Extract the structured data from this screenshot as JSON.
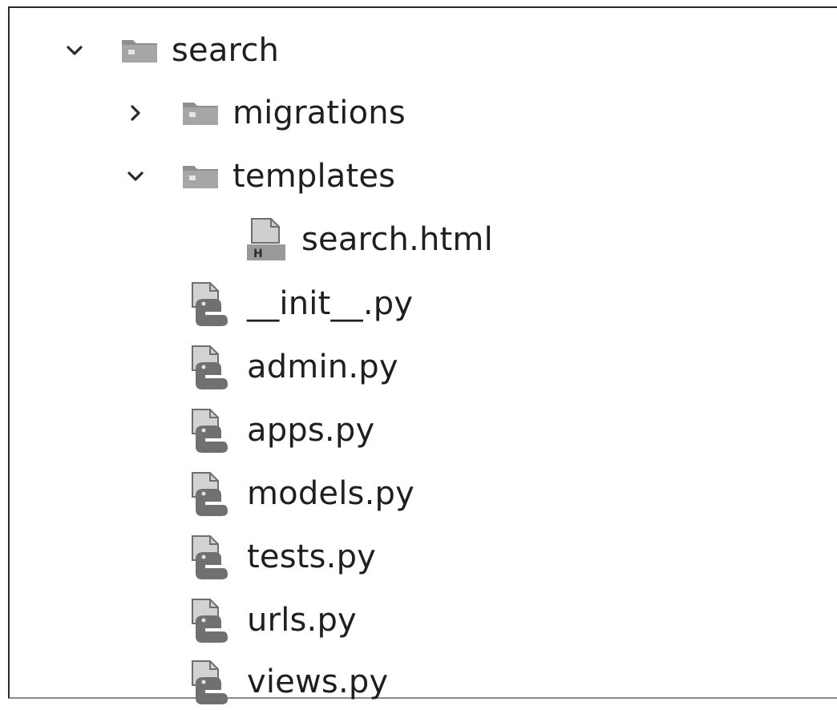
{
  "tree": {
    "root": {
      "label": "search",
      "expanded": true,
      "icon": "folder-icon"
    },
    "items": [
      {
        "label": "migrations",
        "expanded": false,
        "type": "folder",
        "icon": "folder-icon"
      },
      {
        "label": "templates",
        "expanded": true,
        "type": "folder",
        "icon": "folder-icon"
      },
      {
        "label": "search.html",
        "type": "file",
        "icon": "html-file-icon"
      },
      {
        "label": "__init__.py",
        "type": "file",
        "icon": "python-file-icon"
      },
      {
        "label": "admin.py",
        "type": "file",
        "icon": "python-file-icon"
      },
      {
        "label": "apps.py",
        "type": "file",
        "icon": "python-file-icon"
      },
      {
        "label": "models.py",
        "type": "file",
        "icon": "python-file-icon"
      },
      {
        "label": "tests.py",
        "type": "file",
        "icon": "python-file-icon"
      },
      {
        "label": "urls.py",
        "type": "file",
        "icon": "python-file-icon"
      },
      {
        "label": "views.py",
        "type": "file",
        "icon": "python-file-icon"
      }
    ]
  }
}
